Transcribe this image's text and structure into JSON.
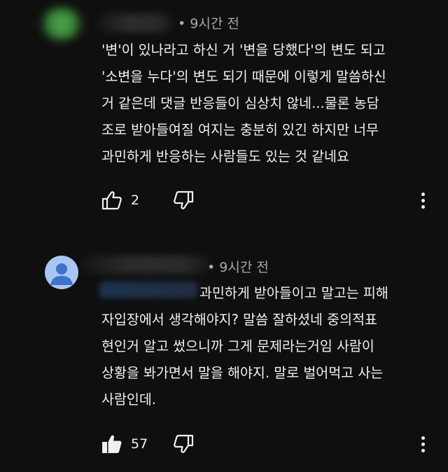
{
  "comments": [
    {
      "author": "",
      "time": "• 9시간 전",
      "text": "'변'이 있나라고 하신 거 '변을 당했다'의 변도 되고\n'소변을 누다'의 변도 되기 때문에 이렇게 말씀하신\n거 같은데 댓글 반응들이 심상치 않네...물론 농담\n조로 받아들여질 여지는 충분히 있긴 하지만 너무\n과민하게 반응하는 사람들도 있는 것 같네요",
      "likes": "2",
      "liked": false,
      "avatar_color": "#3a8a3a",
      "icons": {
        "like": "thumb-up-outline-icon",
        "dislike": "thumb-down-outline-icon",
        "more": "more-vert-icon"
      }
    },
    {
      "author": "",
      "time": "• 9시간 전",
      "mention": "",
      "text": "과민하게 받아들이고 말고는 피해\n자입장에서 생각해야지? 말씀 잘하셨네 중의적표\n현인거 알고 썼으니까 그게 문제라는거임 사람이\n상황을 봐가면서 말을 해야지. 말로 벌어먹고 사는\n사람인데.",
      "likes": "57",
      "liked": true,
      "avatar_color": "#a9c6f2",
      "icons": {
        "like": "thumb-up-filled-icon",
        "dislike": "thumb-down-outline-icon",
        "more": "more-vert-icon"
      }
    }
  ]
}
